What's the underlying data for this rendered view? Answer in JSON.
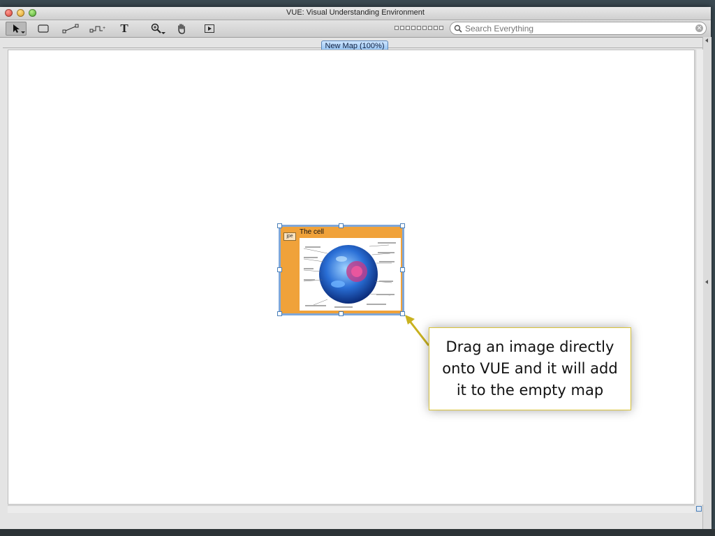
{
  "window": {
    "title": "VUE: Visual Understanding Environment"
  },
  "toolbar": {
    "tools": [
      "select-tool",
      "node-tool",
      "link-tool",
      "curved-link-tool",
      "text-tool",
      "zoom-tool",
      "pan-tool",
      "presentation-tool"
    ],
    "text_tool_glyph": "T"
  },
  "search": {
    "placeholder": "Search Everything",
    "value": ""
  },
  "map_tab": {
    "label": "New Map (100%)"
  },
  "node": {
    "title": "The cell",
    "badge": "jpe",
    "image_icon": "cell-diagram-image",
    "fill_color": "#f0a23a"
  },
  "callout": {
    "text": "Drag an image directly onto VUE and it will add it to the empty map",
    "border_color": "#d9c33a",
    "arrow_color": "#c9b21f"
  }
}
